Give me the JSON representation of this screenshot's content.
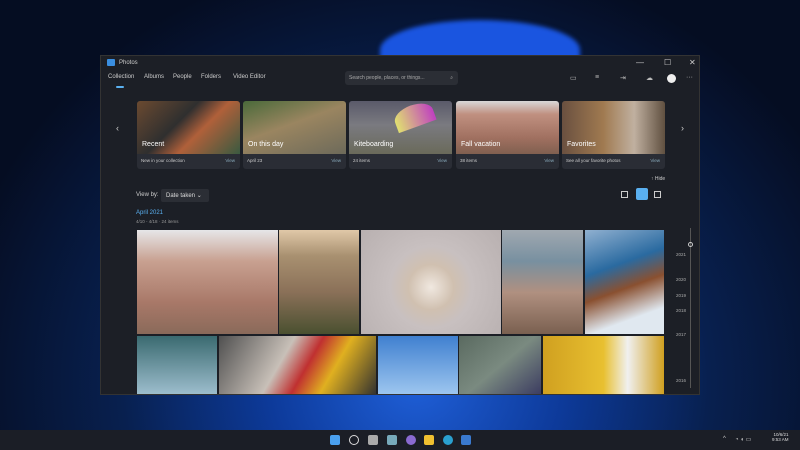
{
  "window": {
    "title": "Photos",
    "min": "—",
    "max": "☐",
    "close": "✕"
  },
  "nav": [
    "Collection",
    "Albums",
    "People",
    "Folders",
    "Video Editor"
  ],
  "search": {
    "placeholder": "Search people, places, or things...",
    "icon": "search-icon"
  },
  "toolbar": {
    "more": "···"
  },
  "cards": [
    {
      "title": "Recent",
      "sub": "New in your collection",
      "view": "View"
    },
    {
      "title": "On this day",
      "sub": "April 23",
      "view": "View"
    },
    {
      "title": "Kiteboarding",
      "sub": "24 items",
      "view": "View"
    },
    {
      "title": "Fall vacation",
      "sub": "38 items",
      "view": "View"
    },
    {
      "title": "Favorites",
      "sub": "See all your favorite photos",
      "view": "View"
    }
  ],
  "hide": "Hide",
  "viewby": {
    "label": "View by:",
    "value": "Date taken"
  },
  "group": {
    "title": "April 2021",
    "sub": "4/10 - 4/18 · 24 items"
  },
  "timeline": [
    "2021",
    "2020",
    "2019",
    "2018",
    "2017",
    "2016"
  ],
  "taskbar": {
    "date": "10/6/21",
    "time": "9:53 AM"
  },
  "colors": {
    "accent": "#5ab0f0"
  }
}
